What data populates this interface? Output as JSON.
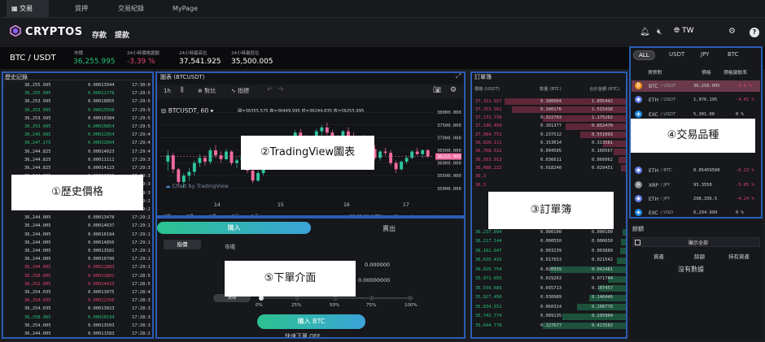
{
  "tabs": [
    {
      "label": "交易"
    },
    {
      "label": "質押"
    },
    {
      "label": "交易紀錄"
    },
    {
      "label": "MyPage"
    }
  ],
  "brand": "CRYPTOS",
  "nav": {
    "deposit": "存款",
    "withdraw": "提款",
    "lang": "TW"
  },
  "ticker": {
    "pair": "BTC / USDT",
    "price_label": "市價",
    "price": "36,255.995",
    "change_label": "24小時價格變動",
    "change": "-3.39 %",
    "high_label": "24小時最高位",
    "high": "37,541.925",
    "low_label": "24小時最低位",
    "low": "35,500.005"
  },
  "history": {
    "title": "歷史記錄",
    "rows": [
      {
        "p": "36,255.995",
        "q": "0.00013944",
        "t": "17:30:0",
        "c": "w"
      },
      {
        "p": "36,255.995",
        "q": "0.00011778",
        "t": "17:29:5",
        "c": "g"
      },
      {
        "p": "36,253.995",
        "q": "0.00010855",
        "t": "17:29:5",
        "c": "w"
      },
      {
        "p": "36,253.995",
        "q": "0.00013568",
        "t": "17:29:5",
        "c": "g"
      },
      {
        "p": "36,253.995",
        "q": "0.00010384",
        "t": "17:29:5",
        "c": "w"
      },
      {
        "p": "36,253.995",
        "q": "0.00010854",
        "t": "17:29:5",
        "c": "g"
      },
      {
        "p": "36,245.995",
        "q": "0.00012054",
        "t": "17:29:4",
        "c": "g"
      },
      {
        "p": "36,247.175",
        "q": "0.00012604",
        "t": "17:29:4",
        "c": "g"
      },
      {
        "p": "36,244.825",
        "q": "0.00014023",
        "t": "17:29:4",
        "c": "w"
      },
      {
        "p": "36,244.825",
        "q": "0.00011111",
        "t": "17:29:3",
        "c": "w"
      },
      {
        "p": "36,244.825",
        "q": "0.00014123",
        "t": "17:29:3",
        "c": "w"
      },
      {
        "p": "36,244.825",
        "q": "0.00011301",
        "t": "17:29:3",
        "c": "w"
      },
      {
        "p": "36,244.825",
        "q": "0.00010922",
        "t": "17:29:3",
        "c": "w"
      },
      {
        "p": "36,244.825",
        "q": "0.00013812",
        "t": "17:29:3",
        "c": "w"
      },
      {
        "p": "36,244.825",
        "q": "0.00012601",
        "t": "17:29:2",
        "c": "w"
      },
      {
        "p": "36,244.825",
        "q": "0.00011901",
        "t": "17:29:2",
        "c": "w"
      },
      {
        "p": "36,244.005",
        "q": "0.00013478",
        "t": "17:29:2",
        "c": "w"
      },
      {
        "p": "36,244.005",
        "q": "0.00014637",
        "t": "17:29:1",
        "c": "w"
      },
      {
        "p": "36,244.005",
        "q": "0.00010194",
        "t": "17:29:1",
        "c": "w"
      },
      {
        "p": "36,244.005",
        "q": "0.00014856",
        "t": "17:29:1",
        "c": "w"
      },
      {
        "p": "36,244.005",
        "q": "0.00013581",
        "t": "17:29:1",
        "c": "w"
      },
      {
        "p": "36,244.005",
        "q": "0.00010790",
        "t": "17:29:1",
        "c": "w"
      },
      {
        "p": "36,244.005",
        "q": "0.00012883",
        "t": "17:29:1",
        "c": "r"
      },
      {
        "p": "36,250.005",
        "q": "0.00011801",
        "t": "17:28:5",
        "c": "r"
      },
      {
        "p": "36,252.005",
        "q": "0.00014423",
        "t": "17:28:5",
        "c": "r"
      },
      {
        "p": "36,254.035",
        "q": "0.00013075",
        "t": "17:28:4",
        "c": "w"
      },
      {
        "p": "36,254.035",
        "q": "0.00012356",
        "t": "17:28:3",
        "c": "r"
      },
      {
        "p": "36,254.035",
        "q": "0.00013823",
        "t": "17:28:3",
        "c": "w"
      },
      {
        "p": "36,258.965",
        "q": "0.00010194",
        "t": "17:28:3",
        "c": "g"
      },
      {
        "p": "36,254.005",
        "q": "0.00013503",
        "t": "17:28:3",
        "c": "w"
      },
      {
        "p": "36,244.005",
        "q": "0.00011583",
        "t": "17:28:2",
        "c": "w"
      }
    ]
  },
  "chart": {
    "title": "圖表 (BTCUSDT)",
    "toolbar": {
      "interval": "1h",
      "compare": "對比",
      "indicator": "指標"
    },
    "legend": {
      "symbol": "BTCUSDT, 60",
      "open": "開=36355.575",
      "high": "高=36449.995",
      "low": "低=36244.835",
      "close": "收=36255.995"
    },
    "watermark": "Chart by TradingView",
    "price_ticks": [
      "38000.000",
      "37500.000",
      "37000.000",
      "36500.000",
      "36000.000",
      "35500.000",
      "35000.000"
    ],
    "last_price": "36255.995",
    "date_ticks": [
      "14",
      "15",
      "16",
      "17"
    ],
    "timeframes": [
      "6月",
      "3月",
      "1月",
      "5天",
      "1天"
    ],
    "clock": "07:30:02 (UTC)",
    "bottom_opts": [
      "%",
      "log",
      "auto"
    ]
  },
  "chart_data": {
    "type": "candlestick",
    "y_range": [
      34800,
      38200
    ],
    "candles": [
      [
        36050,
        36500,
        35700,
        36300
      ],
      [
        36300,
        36400,
        35600,
        35750
      ],
      [
        35750,
        35800,
        35100,
        35250
      ],
      [
        35250,
        35600,
        35000,
        35500
      ],
      [
        35500,
        35800,
        35300,
        35650
      ],
      [
        35650,
        36100,
        35500,
        36000
      ],
      [
        36000,
        36350,
        35850,
        36200
      ],
      [
        36200,
        36300,
        35900,
        36050
      ],
      [
        36050,
        36600,
        35950,
        36500
      ],
      [
        36500,
        36700,
        36200,
        36300
      ],
      [
        36300,
        36450,
        36000,
        36150
      ],
      [
        36150,
        36550,
        36100,
        36450
      ],
      [
        36450,
        36500,
        35900,
        36000
      ],
      [
        36000,
        36200,
        35800,
        36100
      ],
      [
        36100,
        36300,
        35950,
        36250
      ],
      [
        36250,
        36400,
        35600,
        35700
      ],
      [
        35700,
        35800,
        35200,
        35300
      ],
      [
        35300,
        35700,
        35250,
        35600
      ],
      [
        35600,
        36000,
        35500,
        35900
      ],
      [
        35900,
        36400,
        35800,
        36300
      ],
      [
        36300,
        36500,
        36100,
        36400
      ],
      [
        36400,
        36550,
        36200,
        36300
      ],
      [
        36300,
        36700,
        36250,
        36600
      ],
      [
        36600,
        37000,
        36500,
        36900
      ],
      [
        36900,
        37300,
        36700,
        37200
      ],
      [
        37200,
        37350,
        36900,
        37000
      ],
      [
        37000,
        37100,
        36700,
        36800
      ],
      [
        36800,
        37050,
        36650,
        36950
      ],
      [
        36950,
        37350,
        36900,
        37250
      ],
      [
        37250,
        37500,
        37100,
        37400
      ],
      [
        37400,
        37600,
        37100,
        37200
      ],
      [
        37200,
        37300,
        36800,
        36900
      ],
      [
        36900,
        37100,
        36700,
        37000
      ],
      [
        37000,
        37300,
        36900,
        37250
      ],
      [
        37250,
        37400,
        36950,
        37050
      ],
      [
        37050,
        37200,
        36600,
        36700
      ],
      [
        36700,
        36900,
        36500,
        36850
      ],
      [
        36850,
        37100,
        36800,
        37000
      ],
      [
        37000,
        37050,
        36500,
        36550
      ],
      [
        36550,
        36700,
        36100,
        36200
      ],
      [
        36200,
        36500,
        36100,
        36450
      ],
      [
        36450,
        36600,
        36300,
        36400
      ],
      [
        36400,
        36500,
        35900,
        36000
      ],
      [
        36000,
        36100,
        35600,
        35750
      ],
      [
        35750,
        36100,
        35700,
        36050
      ],
      [
        36050,
        36300,
        35950,
        36200
      ],
      [
        36200,
        36500,
        36150,
        36450
      ],
      [
        36450,
        36600,
        36300,
        36350
      ],
      [
        36350,
        36550,
        36200,
        36500
      ],
      [
        36500,
        36550,
        36200,
        36256
      ]
    ]
  },
  "order": {
    "buy_tab": "購入",
    "sell_tab": "賣出",
    "limit": "指價",
    "market": "市場",
    "val1": "0.000000",
    "val2": "0.00000000",
    "clear": "清除",
    "pcts": [
      "0%",
      "25%",
      "50%",
      "75%",
      "100%"
    ],
    "buy_btn": "購入 BTC",
    "quick": "快速下單 OFF"
  },
  "orderbook": {
    "title": "訂單簿",
    "col_price": "價格 (USDT)",
    "col_qty": "數量 (BTC)",
    "col_total": "合計金額 (BTC)",
    "asks": [
      {
        "p": "37,321.927",
        "q": "0.380004",
        "t": "1.895442",
        "d": 0.8
      },
      {
        "p": "37,253.561",
        "q": "0.340176",
        "t": "1.515438",
        "d": 0.75
      },
      {
        "p": "37,231.739",
        "q": "0.322793",
        "t": "1.175262",
        "d": 0.55
      },
      {
        "p": "37,196.450",
        "q": "0.301377",
        "t": "0.852470",
        "d": 0.4
      },
      {
        "p": "37,084.751",
        "q": "0.237512",
        "t": "0.551093",
        "d": 0.3
      },
      {
        "p": "36,920.111",
        "q": "0.153014",
        "t": "0.313581",
        "d": 0.15
      },
      {
        "p": "36,768.512",
        "q": "0.094505",
        "t": "0.160567",
        "d": 0.08
      },
      {
        "p": "36,563.013",
        "q": "0.036611",
        "t": "0.066062",
        "d": 0.05
      },
      {
        "p": "36,480.222",
        "q": "0.018240",
        "t": "0.029451",
        "d": 0.03
      },
      {
        "p": "36,3",
        "q": "",
        "t": "",
        "d": 0.0
      },
      {
        "p": "36,3",
        "q": "",
        "t": "",
        "d": 0.0
      }
    ],
    "bids": [
      {
        "p": "36,237.894",
        "q": "0.000100",
        "t": "0.000100",
        "d": 0.02
      },
      {
        "p": "36,217.144",
        "q": "0.000550",
        "t": "0.000650",
        "d": 0.03
      },
      {
        "p": "36,161.647",
        "q": "0.003239",
        "t": "0.003889",
        "d": 0.04
      },
      {
        "p": "36,035.416",
        "q": "0.017653",
        "t": "0.021542",
        "d": 0.06
      },
      {
        "p": "36,020.754",
        "q": "0.020939",
        "t": "0.042481",
        "d": 0.5
      },
      {
        "p": "35,971.655",
        "q": "0.029263",
        "t": "0.071744",
        "d": 0.12
      },
      {
        "p": "35,939.683",
        "q": "0.035713",
        "t": "0.107457",
        "d": 0.18
      },
      {
        "p": "35,927.450",
        "q": "0.038989",
        "t": "0.146446",
        "d": 0.24
      },
      {
        "p": "35,834.551",
        "q": "0.060324",
        "t": "0.206770",
        "d": 0.32
      },
      {
        "p": "35,742.774",
        "q": "0.089135",
        "t": "0.295904",
        "d": 0.42
      },
      {
        "p": "35,644.778",
        "q": "0.127677",
        "t": "0.423582",
        "d": 0.55
      }
    ]
  },
  "market": {
    "tabs": [
      "ALL",
      "USDT",
      "JPY",
      "BTC"
    ],
    "col_pair": "貨幣對",
    "col_price": "價格",
    "col_change": "價格變動率",
    "rows": [
      {
        "sym": "BTC",
        "quote": "/ USDT",
        "price": "36,250.005",
        "chg": "-3.4 %",
        "icon": "btc",
        "hl": true
      },
      {
        "sym": "ETH",
        "quote": "/ USDT",
        "price": "1,976.195",
        "chg": "-4.01 %",
        "icon": "eth",
        "hl": false
      },
      {
        "sym": "EXC",
        "quote": "/ USDT",
        "price": "5,301.00",
        "chg": "0 %",
        "icon": "exc",
        "hl": false
      },
      {
        "sym": "ETH",
        "quote": "/ BTC",
        "price": "0.05459500",
        "chg": "-0.23 %",
        "icon": "eth",
        "hl": false
      },
      {
        "sym": "XRP",
        "quote": "/ JPY",
        "price": "93.3550",
        "chg": "-5.05 %",
        "icon": "xrp",
        "hl": false
      },
      {
        "sym": "ETH",
        "quote": "/ JPY",
        "price": "298,336.5",
        "chg": "-4.24 %",
        "icon": "eth",
        "hl": false
      },
      {
        "sym": "EXC",
        "quote": "/ USD",
        "price": "6,294.999",
        "chg": "0 %",
        "icon": "exc",
        "hl": false
      }
    ]
  },
  "balance": {
    "title": "餘額",
    "show_all": "顯示全部",
    "col_asset": "資產",
    "col_bal": "餘額",
    "col_hold": "持有資產",
    "empty": "沒有數據"
  },
  "callouts": {
    "history": "①歷史價格",
    "chart": "②TradingView圖表",
    "book": "③訂單簿",
    "market": "④交易品種",
    "order": "⑤下單介面"
  },
  "colors": {
    "up": "#27c27a",
    "down": "#e3446f",
    "frame": "#2b5db4"
  }
}
